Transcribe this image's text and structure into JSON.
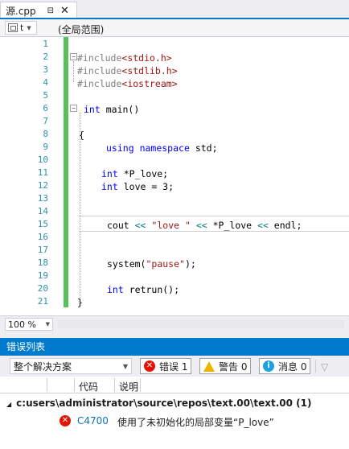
{
  "tab": {
    "name": "源.cpp",
    "pin_icon": "pin-icon",
    "close_icon": "close-icon"
  },
  "navbar": {
    "scope_value": "t",
    "global_scope": "(全局范围)"
  },
  "editor": {
    "line_numbers": [
      "1",
      "2",
      "3",
      "4",
      "5",
      "6",
      "7",
      "8",
      "9",
      "10",
      "11",
      "12",
      "13",
      "14",
      "15",
      "16",
      "17",
      "18",
      "19",
      "20",
      "21"
    ],
    "code": {
      "l2_pp": "#include",
      "l2_inc": "<stdio.h>",
      "l3_pp": "#include",
      "l3_inc": "<stdlib.h>",
      "l4_pp": "#include",
      "l4_inc": "<iostream>",
      "l6_kw": "int",
      "l6_rest": "main()",
      "l8": "{",
      "l9_kw1": "using",
      "l9_kw2": "namespace",
      "l9_rest": "std;",
      "l11_kw": "int",
      "l11_rest": "*P_love;",
      "l12_kw": "int",
      "l12_rest": "love = 3;",
      "l15_a": "cout ",
      "l15_op1": "<<",
      "l15_str": "\"love \"",
      "l15_op2": "<<",
      "l15_b": "*P_love ",
      "l15_op3": "<<",
      "l15_c": " endl;",
      "l18_a": "system(",
      "l18_str": "\"pause\"",
      "l18_b": ");",
      "l20_kw": "int",
      "l20_rest": "retrun();",
      "l21": "}"
    }
  },
  "zoom": {
    "value": "100 %"
  },
  "error_list": {
    "title": "错误列表",
    "scope_select": "整个解决方案",
    "errors_button": "错误 1",
    "warnings_button": "警告 0",
    "messages_button": "消息 0",
    "columns": {
      "code": "代码",
      "description": "说明"
    },
    "group_path": "c:users\\administrator\\source\\repos\\text.00\\text.00 (1)",
    "rows": [
      {
        "code": "C4700",
        "description": "使用了未初始化的局部变量“P_love”"
      }
    ]
  },
  "colors": {
    "accent": "#007acc",
    "changebar": "#57c057",
    "line_number": "#2b91af",
    "keyword": "#0000ff",
    "string": "#a31515"
  }
}
